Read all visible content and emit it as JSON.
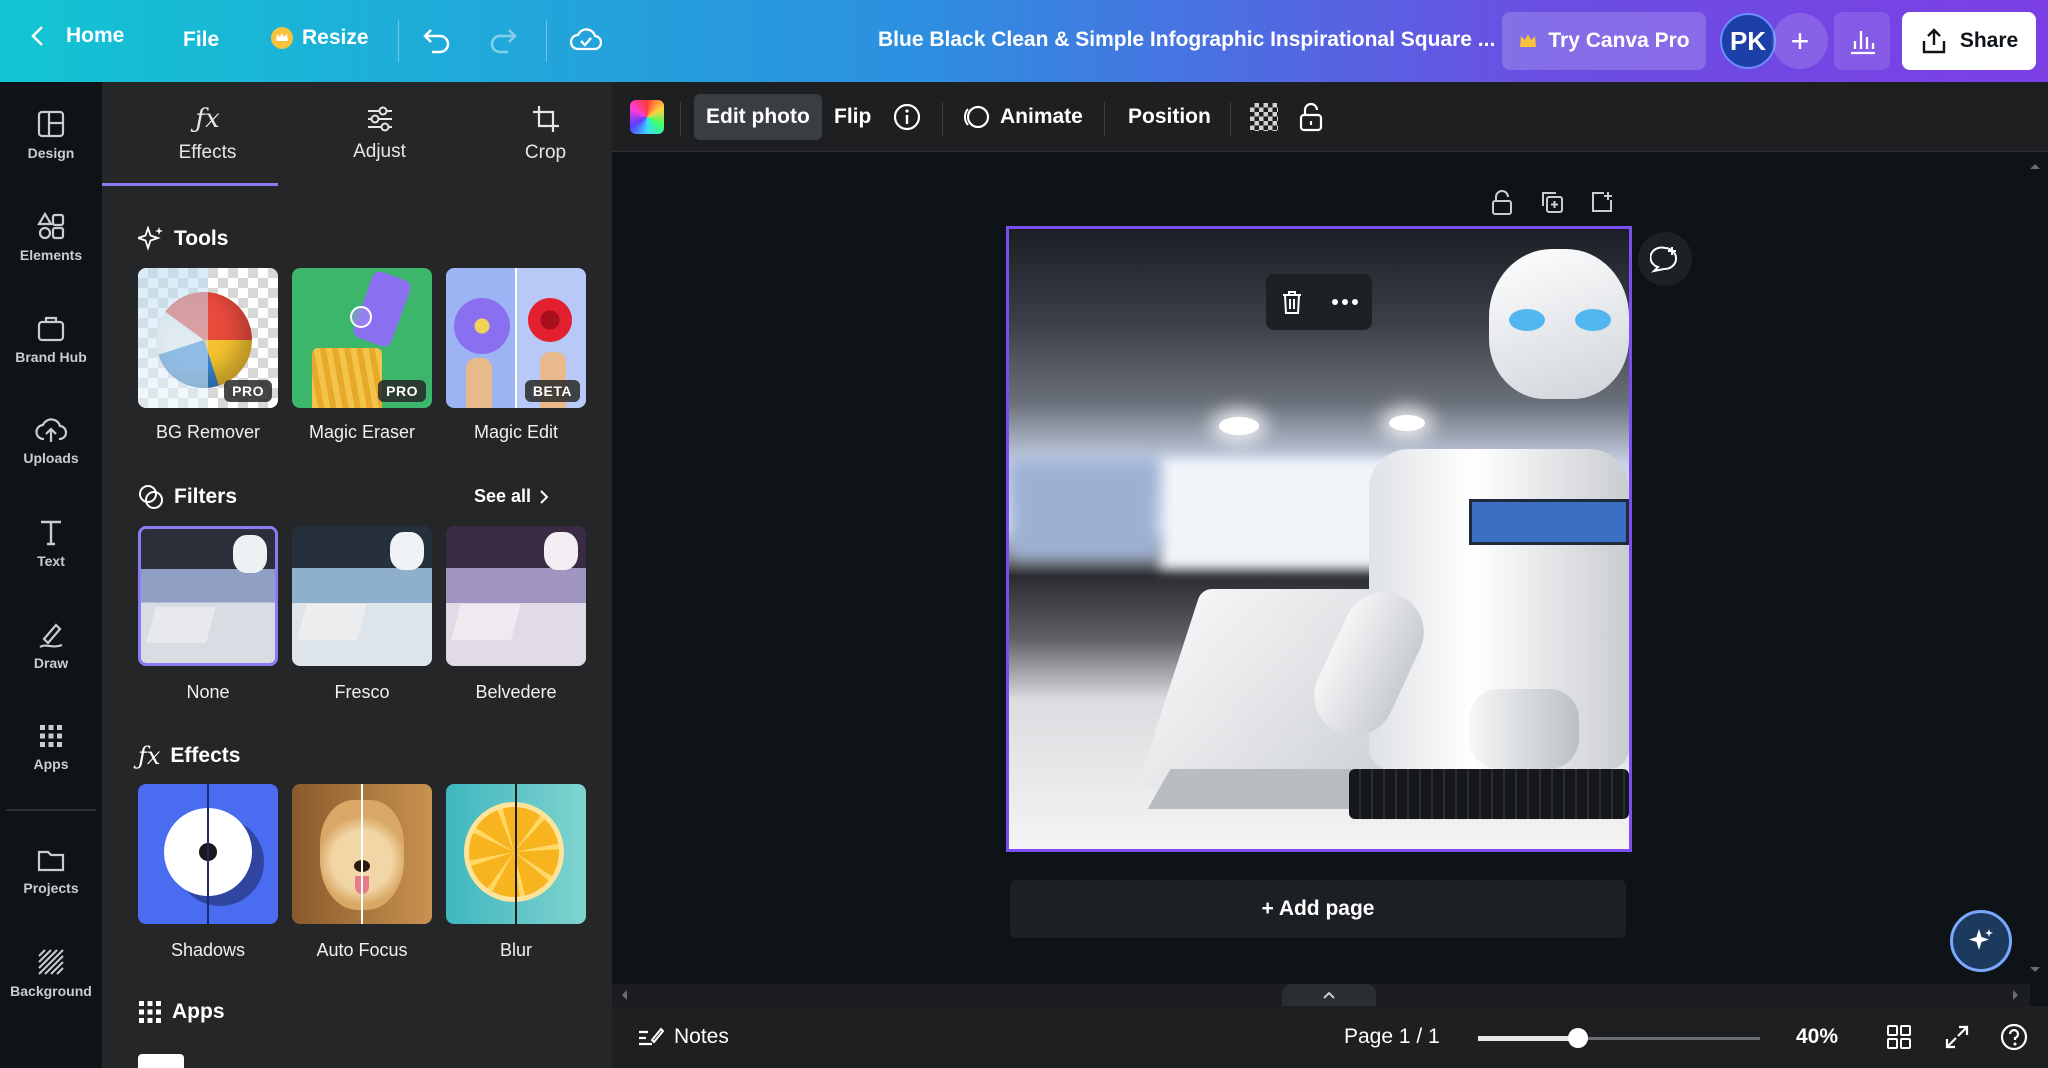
{
  "header": {
    "home_label": "Home",
    "file_label": "File",
    "resize_label": "Resize",
    "document_title": "Blue Black Clean & Simple Infographic Inspirational Square ...",
    "try_pro_label": "Try Canva Pro",
    "avatar_initials": "PK",
    "share_label": "Share"
  },
  "rail": {
    "items": [
      {
        "label": "Design",
        "icon": "layout-icon"
      },
      {
        "label": "Elements",
        "icon": "shapes-icon"
      },
      {
        "label": "Brand Hub",
        "icon": "brand-icon"
      },
      {
        "label": "Uploads",
        "icon": "upload-cloud-icon"
      },
      {
        "label": "Text",
        "icon": "text-icon"
      },
      {
        "label": "Draw",
        "icon": "pen-icon"
      },
      {
        "label": "Apps",
        "icon": "grid-icon"
      },
      {
        "label": "Projects",
        "icon": "folder-icon"
      },
      {
        "label": "Background",
        "icon": "pattern-icon"
      }
    ]
  },
  "panel": {
    "tabs": [
      {
        "label": "Effects",
        "icon": "fx-icon"
      },
      {
        "label": "Adjust",
        "icon": "sliders-icon"
      },
      {
        "label": "Crop",
        "icon": "crop-icon"
      }
    ],
    "tools": {
      "title": "Tools",
      "items": [
        {
          "label": "BG Remover",
          "badge": "PRO"
        },
        {
          "label": "Magic Eraser",
          "badge": "PRO"
        },
        {
          "label": "Magic Edit",
          "badge": "BETA"
        }
      ]
    },
    "filters": {
      "title": "Filters",
      "see_all": "See all",
      "items": [
        {
          "label": "None"
        },
        {
          "label": "Fresco"
        },
        {
          "label": "Belvedere"
        }
      ]
    },
    "effects": {
      "title": "Effects",
      "items": [
        {
          "label": "Shadows"
        },
        {
          "label": "Auto Focus"
        },
        {
          "label": "Blur"
        }
      ]
    },
    "apps": {
      "title": "Apps"
    }
  },
  "edit_toolbar": {
    "edit_photo_label": "Edit photo",
    "flip_label": "Flip",
    "animate_label": "Animate",
    "position_label": "Position"
  },
  "canvas": {
    "add_page_label": "+ Add page"
  },
  "bottombar": {
    "notes_label": "Notes",
    "page_indicator": "Page 1 / 1",
    "zoom_label": "40%",
    "zoom_fraction": 0.4
  },
  "colors": {
    "accent": "#7d4ff0",
    "panel_bg": "#252627",
    "canvas_bg": "#0e1318"
  }
}
